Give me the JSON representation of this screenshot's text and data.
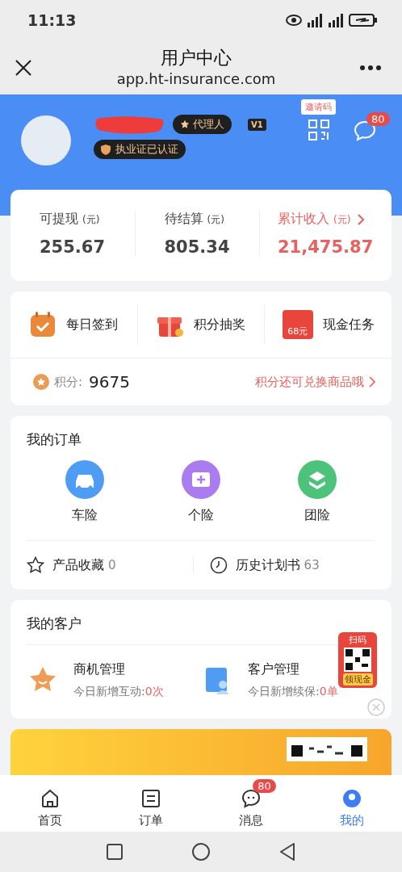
{
  "status_bar": {
    "time": "11:13"
  },
  "nav": {
    "title": "用户中心",
    "url": "app.ht-insurance.com"
  },
  "profile": {
    "role_badge": "代理人",
    "level_badge": "V1",
    "certified_badge": "执业证已认证",
    "invite_label": "邀请码",
    "message_count": "80"
  },
  "earnings": [
    {
      "label": "可提现",
      "unit": "(元)",
      "value": "255.67",
      "highlight": false,
      "link": false
    },
    {
      "label": "待结算",
      "unit": "(元)",
      "value": "805.34",
      "highlight": false,
      "link": false
    },
    {
      "label": "累计收入",
      "unit": "(元)",
      "value": "21,475.87",
      "highlight": true,
      "link": true
    }
  ],
  "tasks": [
    {
      "kind": "calendar",
      "label": "每日签到"
    },
    {
      "kind": "gift",
      "label": "积分抽奖"
    },
    {
      "kind": "cash",
      "label": "现金任务",
      "tag": "68元"
    }
  ],
  "points": {
    "label": "积分:",
    "value": "9675",
    "link": "积分还可兑换商品哦"
  },
  "orders": {
    "title": "我的订单",
    "items": [
      {
        "kind": "car",
        "label": "车险",
        "color": "#4f9cf5"
      },
      {
        "kind": "plus",
        "label": "个险",
        "color": "#a97cf0"
      },
      {
        "kind": "stack",
        "label": "团险",
        "color": "#4cc27a"
      }
    ],
    "links": [
      {
        "kind": "star",
        "label": "产品收藏",
        "count": "0"
      },
      {
        "kind": "clock",
        "label": "历史计划书",
        "count": "63"
      }
    ]
  },
  "customers": {
    "title": "我的客户",
    "items": [
      {
        "kind": "star",
        "title": "商机管理",
        "caption": "今日新增互动:",
        "count": "0次"
      },
      {
        "kind": "person",
        "title": "客户管理",
        "caption": "今日新增续保:",
        "count": "0单"
      }
    ]
  },
  "promo": {
    "top": "扫码",
    "label": "领现金"
  },
  "tabs": [
    {
      "kind": "home",
      "label": "首页",
      "selected": false
    },
    {
      "kind": "list",
      "label": "订单",
      "selected": false
    },
    {
      "kind": "chat",
      "label": "消息",
      "selected": false,
      "badge": "80"
    },
    {
      "kind": "user",
      "label": "我的",
      "selected": true
    }
  ]
}
